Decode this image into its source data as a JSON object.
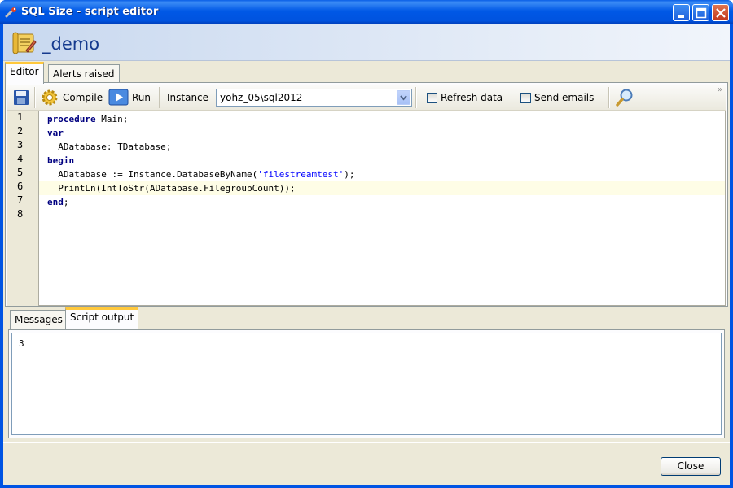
{
  "window": {
    "title": "SQL Size - script editor",
    "icon": "wrench-icon"
  },
  "header": {
    "title": "_demo",
    "icon": "scroll-icon"
  },
  "tabs_top": [
    {
      "label": "Editor",
      "active": true
    },
    {
      "label": "Alerts raised",
      "active": false
    }
  ],
  "toolbar": {
    "save_icon": "floppy-disk-icon",
    "compile_label": "Compile",
    "run_label": "Run",
    "instance_label": "Instance",
    "instance_value": "yohz_05\\sql2012",
    "refresh_label": "Refresh data",
    "refresh_checked": false,
    "send_emails_label": "Send emails",
    "send_emails_checked": false,
    "search_icon": "magnifier-icon",
    "overflow_icon": "chevron-double-right-icon"
  },
  "editor": {
    "line_numbers": [
      "1",
      "2",
      "3",
      "4",
      "5",
      "6",
      "7",
      "8"
    ],
    "highlighted_line": 6,
    "lines": [
      [
        {
          "t": "procedure",
          "k": "kw"
        },
        {
          "t": " Main;",
          "k": ""
        }
      ],
      [
        {
          "t": "var",
          "k": "kw"
        }
      ],
      [
        {
          "t": "  ADatabase: TDatabase;",
          "k": ""
        }
      ],
      [
        {
          "t": "begin",
          "k": "kw"
        }
      ],
      [
        {
          "t": "  ADatabase := Instance.DatabaseByName(",
          "k": ""
        },
        {
          "t": "'filestreamtest'",
          "k": "str"
        },
        {
          "t": ");",
          "k": ""
        }
      ],
      [
        {
          "t": "  PrintLn(IntToStr(ADatabase.FilegroupCount));",
          "k": ""
        }
      ],
      [
        {
          "t": "end",
          "k": "kw"
        },
        {
          "t": ";",
          "k": ""
        }
      ],
      []
    ]
  },
  "tabs_bottom": [
    {
      "label": "Messages",
      "active": false
    },
    {
      "label": "Script output",
      "active": true
    }
  ],
  "output": {
    "text": "3"
  },
  "footer": {
    "close_label": "Close"
  }
}
